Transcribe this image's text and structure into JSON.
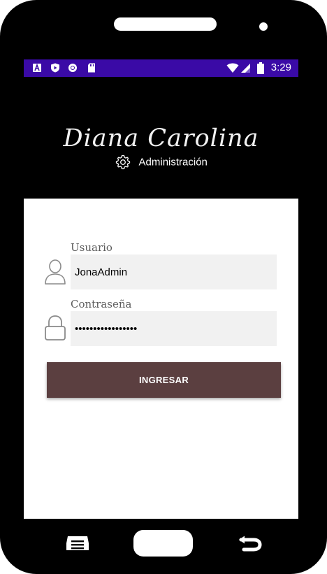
{
  "status_bar": {
    "time": "3:29",
    "left_icons": [
      "font-a-icon",
      "shield-play-icon",
      "record-icon",
      "sd-card-icon"
    ],
    "right_icons": [
      "wifi-icon",
      "signal-icon",
      "battery-icon"
    ]
  },
  "header": {
    "brand": "Diana Carolina",
    "subtitle": "Administración",
    "background": "#000000"
  },
  "form": {
    "username_label": "Usuario",
    "username_value": "JonaAdmin",
    "password_label": "Contraseña",
    "password_value": "•••••••••••••••••",
    "submit_label": "INGRESAR",
    "button_color": "#5b3f40"
  },
  "colors": {
    "status_bar": "#3a0aa6",
    "field_background": "#f1f1f1"
  }
}
